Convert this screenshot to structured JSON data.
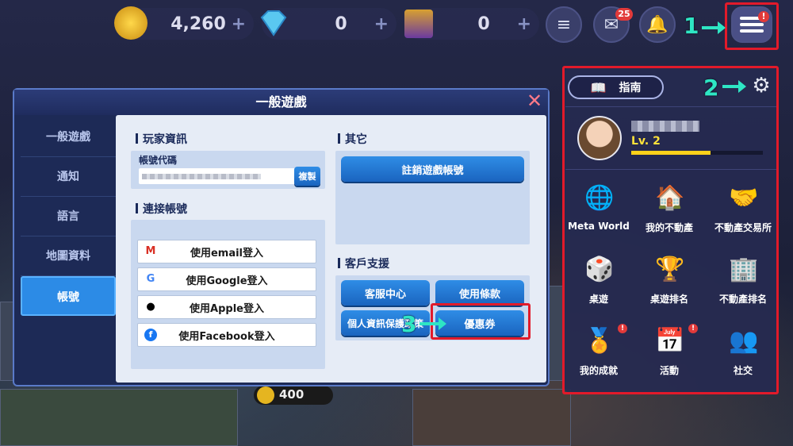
{
  "topbar": {
    "coins": "4,260",
    "gems": "0",
    "tickets": "0",
    "plus": "+",
    "mail_badge": "25",
    "menu_badge": "!"
  },
  "dialog": {
    "title": "一般遊戲",
    "close": "✕",
    "nav": [
      "一般遊戲",
      "通知",
      "語言",
      "地圖資料",
      "帳號"
    ],
    "player_info": {
      "heading": "玩家資訊",
      "account_code_label": "帳號代碼",
      "copy_button": "複製"
    },
    "linked": {
      "heading": "連接帳號",
      "buttons": [
        "使用email登入",
        "使用Google登入",
        "使用Apple登入",
        "使用Facebook登入"
      ]
    },
    "other": {
      "heading": "其它",
      "delete_account": "註銷遊戲帳號"
    },
    "support": {
      "heading": "客戶支援",
      "buttons": [
        "客服中心",
        "使用條款",
        "個人資訊保護政策",
        "優惠券"
      ]
    }
  },
  "side_menu": {
    "guide": "指南",
    "level": "Lv. 2",
    "level_progress": 0.6,
    "items": [
      "Meta World",
      "我的不動產",
      "不動產交易所",
      "桌遊",
      "桌遊排名",
      "不動產排名",
      "我的成就",
      "活動",
      "社交"
    ],
    "item_badge": "!"
  },
  "background": {
    "chip_value": "400"
  },
  "callouts": [
    "1",
    "2",
    "3"
  ],
  "colors": {
    "highlight": "#e21a2a",
    "callout": "#2ee6c4",
    "button_blue": "#2a7ad6"
  }
}
